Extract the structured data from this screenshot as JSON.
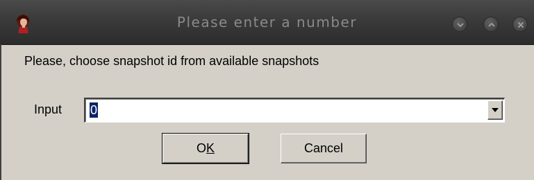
{
  "window": {
    "title": "Please enter a number",
    "icons": {
      "app": "app-avatar-icon",
      "minimize": "chevron-down-icon",
      "maximize": "chevron-up-icon",
      "close": "close-icon"
    },
    "colors": {
      "titlebar": "#3a3a3a",
      "title_text": "#8a8a8a",
      "dialog_bg": "#d4d0c8",
      "selection": "#0a246a"
    }
  },
  "dialog": {
    "prompt": "Please, choose snapshot id from available snapshots",
    "input_label": "Input",
    "input_value": "0",
    "ok_label_prefix": "O",
    "ok_label_mnemonic": "K",
    "cancel_label": "Cancel"
  }
}
